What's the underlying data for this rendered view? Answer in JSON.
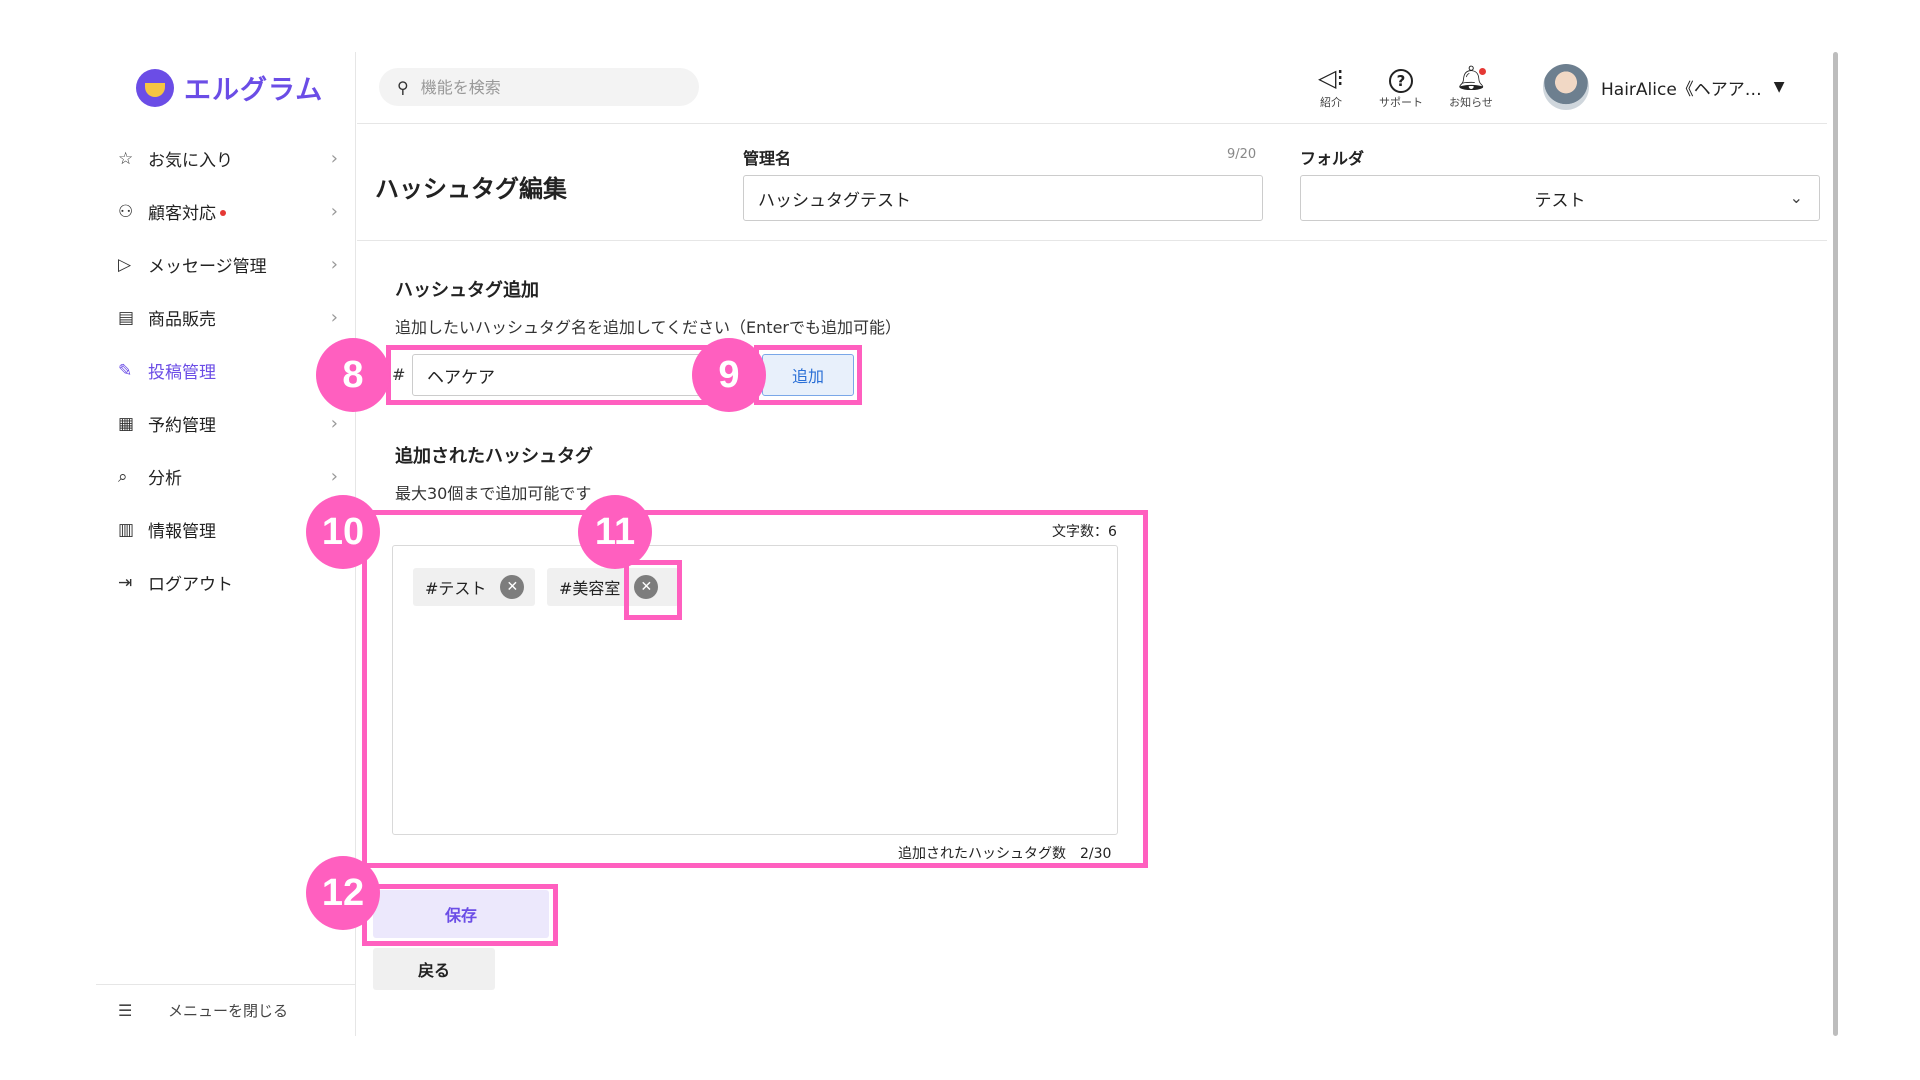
{
  "app": {
    "logo_text": "エルグラム",
    "accent_color": "#6b4de6",
    "annotation_color": "#ff5fbf"
  },
  "sidebar": {
    "items": [
      {
        "label": "お気に入り",
        "icon": "star-icon",
        "glyph": "☆"
      },
      {
        "label": "顧客対応",
        "icon": "person-icon",
        "glyph": "⚇"
      },
      {
        "label": "メッセージ管理",
        "icon": "send-icon",
        "glyph": "▷"
      },
      {
        "label": "商品販売",
        "icon": "store-icon",
        "glyph": "▤"
      },
      {
        "label": "投稿管理",
        "icon": "edit-icon",
        "glyph": "✎"
      },
      {
        "label": "予約管理",
        "icon": "calendar-icon",
        "glyph": "▦"
      },
      {
        "label": "分析",
        "icon": "analysis-icon",
        "glyph": "⌕"
      },
      {
        "label": "情報管理",
        "icon": "bar-chart-icon",
        "glyph": "▥"
      },
      {
        "label": "ログアウト",
        "icon": "logout-icon",
        "glyph": "⇥"
      }
    ],
    "close_menu_label": "メニューを閉じる"
  },
  "topbar": {
    "search_placeholder": "機能を検索",
    "intro_label": "紹介",
    "support_label": "サポート",
    "notice_label": "お知らせ",
    "user_name": "HairAlice《ヘアア…"
  },
  "header": {
    "page_title": "ハッシュタグ編集",
    "name_label": "管理名",
    "name_counter": "9/20",
    "name_value": "ハッシュタグテスト",
    "folder_label": "フォルダ",
    "folder_value": "テスト"
  },
  "add_section": {
    "title": "ハッシュタグ追加",
    "help": "追加したいハッシュタグ名を追加してください（Enterでも追加可能）",
    "prefix": "#",
    "input_value": "ヘアケア",
    "add_label": "追加"
  },
  "added_section": {
    "title": "追加されたハッシュタグ",
    "help": "最大30個まで追加可能です",
    "char_count": "文字数：6",
    "tags": [
      {
        "label": "#テスト"
      },
      {
        "label": "#美容室"
      }
    ],
    "tag_count": "追加されたハッシュタグ数　2/30"
  },
  "actions": {
    "save_label": "保存",
    "back_label": "戻る"
  },
  "annotations": {
    "badge_8": "8",
    "badge_9": "9",
    "badge_10": "10",
    "badge_11": "11",
    "badge_12": "12"
  }
}
